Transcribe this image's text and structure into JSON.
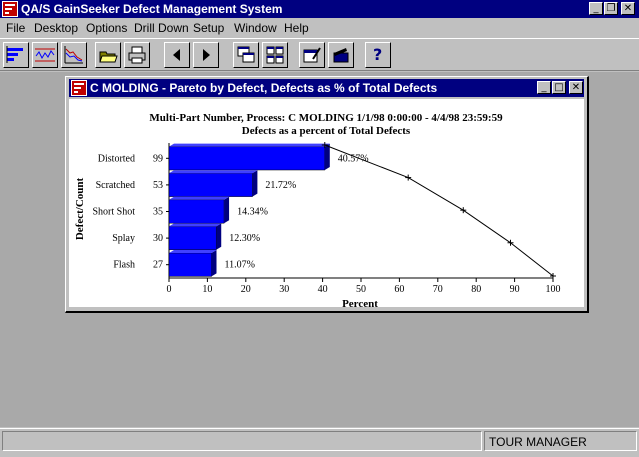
{
  "app": {
    "title": "QA/S GainSeeker Defect Management System",
    "controls": {
      "minimize": "_",
      "restore": "❐",
      "close": "✕"
    }
  },
  "menu": [
    {
      "label": "File"
    },
    {
      "label": "Desktop"
    },
    {
      "label": "Options"
    },
    {
      "label": "Drill Down"
    },
    {
      "label": "Setup"
    },
    {
      "label": "Window"
    },
    {
      "label": "Help"
    }
  ],
  "toolbar": {
    "icons": [
      "pareto-chart-icon",
      "control-chart-icon",
      "trend-chart-icon",
      "open-folder-icon",
      "print-icon",
      "arrow-left-icon",
      "arrow-right-icon",
      "cascade-windows-icon",
      "tile-windows-icon",
      "edit-chart-icon",
      "clapper-icon",
      "help-icon"
    ],
    "help_label": "?"
  },
  "child_window": {
    "title": "C MOLDING - Pareto by Defect, Defects as % of Total Defects",
    "controls": {
      "minimize": "_",
      "maximize": "□",
      "close": "✕"
    }
  },
  "chart_data": {
    "type": "bar",
    "orientation": "horizontal",
    "title": "Multi-Part Number, Process: C MOLDING   1/1/98 0:00:00 - 4/4/98 23:59:59",
    "subtitle": "Defects as a percent of Total Defects",
    "xlabel": "Percent",
    "ylabel": "Defect/Count",
    "xlim": [
      0,
      100
    ],
    "xticks": [
      0,
      10,
      20,
      30,
      40,
      50,
      60,
      70,
      80,
      90,
      100
    ],
    "categories": [
      "Distorted",
      "Scratched",
      "Short Shot",
      "Splay",
      "Flash"
    ],
    "counts": [
      99,
      53,
      35,
      30,
      27
    ],
    "values": [
      40.57,
      21.72,
      14.34,
      12.3,
      11.07
    ],
    "value_labels": [
      "40.57%",
      "21.72%",
      "14.34%",
      "12.30%",
      "11.07%"
    ],
    "cumulative": [
      40.57,
      62.29,
      76.63,
      88.93,
      100.0
    ],
    "bar_color": "#0000ff",
    "grid": false,
    "legend": "none"
  },
  "status": {
    "left": "",
    "right": "TOUR MANAGER"
  }
}
